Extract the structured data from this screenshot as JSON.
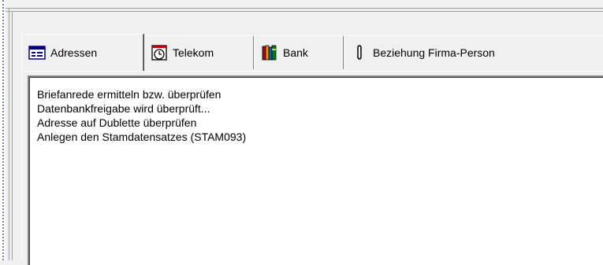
{
  "tabs": [
    {
      "label": "Adressen",
      "icon": "address-card-icon",
      "active": true
    },
    {
      "label": "Telekom",
      "icon": "clock-icon",
      "active": false
    },
    {
      "label": "Bank",
      "icon": "bank-books-icon",
      "active": false
    },
    {
      "label": "Beziehung Firma-Person",
      "icon": "paperclip-icon",
      "active": false
    }
  ],
  "log": {
    "lines": [
      "Briefanrede ermitteln bzw. überprüfen",
      "Datenbankfreigabe wird überprüft...",
      "Adresse auf Dublette überprüfen",
      "Anlegen den Stamdatensatzes (STAM093)"
    ]
  },
  "colors": {
    "window_bg": "#f0f0f0",
    "log_bg": "#ffffff",
    "selection_dots": "#6a7bd6"
  }
}
